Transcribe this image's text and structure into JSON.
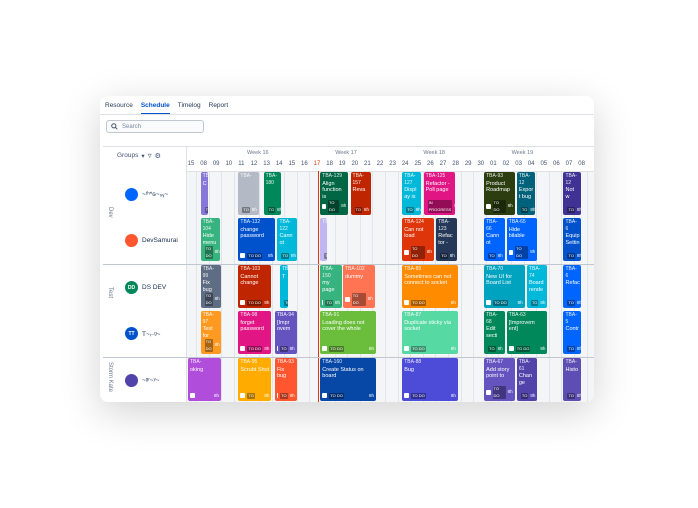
{
  "tabs": [
    "Resource",
    "Schedule",
    "Timelog",
    "Report"
  ],
  "active_tab": 1,
  "search": {
    "placeholder": "Search"
  },
  "groups_label": "Groups",
  "weeks": [
    {
      "label": "Week 16"
    },
    {
      "label": "Week 17"
    },
    {
      "label": "Week 18"
    },
    {
      "label": "Week 19"
    }
  ],
  "days": [
    "15",
    "08",
    "09",
    "10",
    "11",
    "12",
    "13",
    "14",
    "15",
    "16",
    "17",
    "18",
    "19",
    "20",
    "21",
    "22",
    "23",
    "24",
    "25",
    "26",
    "27",
    "28",
    "29",
    "30",
    "01",
    "02",
    "03",
    "04",
    "05",
    "06",
    "07",
    "08"
  ],
  "today_index": 10,
  "groups": [
    "Dev",
    "Test",
    "Storm Kate"
  ],
  "people": [
    {
      "name": "~ᵗʰ*ɢ~₉ᵧ~",
      "initials": "",
      "color": "#0065ff"
    },
    {
      "name": "DevSamurai",
      "initials": "",
      "color": "#ff5630"
    },
    {
      "name": "DS DEV",
      "initials": "DD",
      "color": "#00875a"
    },
    {
      "name": "T~ᵢ₋ᵍ~",
      "initials": "TT",
      "color": "#0052cc"
    },
    {
      "name": "~ᵍʳ~ʸ~",
      "initials": "",
      "color": "#5243aa"
    }
  ],
  "tasks": [
    {
      "id": "TBA-",
      "title": "C",
      "color": "#8777d9",
      "status": "TO",
      "hrs": "8h"
    },
    {
      "id": "TBA-",
      "title": "",
      "color": "#b3bac5",
      "status": "TO",
      "hrs": "8h"
    },
    {
      "id": "TBA-180",
      "title": "",
      "color": "#00875a",
      "status": "TO",
      "hrs": "8h"
    },
    {
      "id": "TBA-129",
      "title": "Align function is",
      "color": "#006644",
      "status": "TO DO",
      "hrs": "8h"
    },
    {
      "id": "TBA-157",
      "title": "Reva",
      "color": "#bf2600",
      "status": "TO",
      "hrs": "8h"
    },
    {
      "id": "TBA-127",
      "title": "Displ ay is",
      "color": "#00b8d9",
      "status": "TO",
      "hrs": "8h"
    },
    {
      "id": "TBA-125",
      "title": "Refactor - Poll page",
      "color": "#e11584",
      "status": "IN PROGRESS",
      "hrs": "8h"
    },
    {
      "id": "TBA-93",
      "title": "Product Roadmap",
      "color": "#2c3e10",
      "status": "TO DO",
      "hrs": "8h"
    },
    {
      "id": "TBA-12",
      "title": "Expor t bug",
      "color": "#00627a",
      "status": "TO",
      "hrs": "8h"
    },
    {
      "id": "TBA-12",
      "title": "Not w",
      "color": "#403294",
      "status": "TO",
      "hrs": "8h"
    },
    {
      "id": "TBA-104",
      "title": "Hide menu",
      "color": "#36b37e",
      "status": "TO DO",
      "hrs": "8h"
    },
    {
      "id": "TBA-132",
      "title": "change password",
      "color": "#0052cc",
      "status": "TO DO",
      "hrs": "8h"
    },
    {
      "id": "TBA-122",
      "title": "Cann ot",
      "color": "#00b8d9",
      "status": "TO",
      "hrs": "8h"
    },
    {
      "id": "TBA-",
      "title": "",
      "color": "#c0b6f2",
      "status": "TO",
      "hrs": "8h"
    },
    {
      "id": "TBA-124",
      "title": "Can not load",
      "color": "#de350b",
      "status": "TO DO",
      "hrs": "8h"
    },
    {
      "id": "TBA-123",
      "title": "Refac tor -",
      "color": "#253858",
      "status": "TO",
      "hrs": "8h"
    },
    {
      "id": "TBA-66",
      "title": "Cann ot",
      "color": "#0065ff",
      "status": "TO",
      "hrs": "8h"
    },
    {
      "id": "TBA-65",
      "title": "Hide bilable",
      "color": "#0065ff",
      "status": "TO DO",
      "hrs": "8h"
    },
    {
      "id": "TBA-6",
      "title": "Equip Settin",
      "color": "#0052cc",
      "status": "TO",
      "hrs": "8h"
    },
    {
      "id": "TBA-99",
      "title": "Fix bug",
      "color": "#5e6c84",
      "status": "TO DO",
      "hrs": "8h"
    },
    {
      "id": "TBA-103",
      "title": "Cannot change",
      "color": "#bf2600",
      "status": "TO DO",
      "hrs": "8h"
    },
    {
      "id": "TBA-",
      "title": "T",
      "color": "#00b8d9",
      "status": "TO",
      "hrs": "8h"
    },
    {
      "id": "TBA-150",
      "title": "my page",
      "color": "#36b37e",
      "status": "TO",
      "hrs": "8h"
    },
    {
      "id": "TBA-102",
      "title": "dummy",
      "color": "#ff7452",
      "status": "TO DO",
      "hrs": "8h"
    },
    {
      "id": "TBA-89",
      "title": "Sometimes can not connect to socket",
      "color": "#ff8b00",
      "status": "TO DO",
      "hrs": "8h"
    },
    {
      "id": "TBA-70",
      "title": "New UI for Board List",
      "color": "#00a3bf",
      "status": "TO DO",
      "hrs": "8h"
    },
    {
      "id": "TBA-74",
      "title": "Board rende",
      "color": "#00b8d9",
      "status": "TO",
      "hrs": "8h"
    },
    {
      "id": "TBA-6",
      "title": "Refac",
      "color": "#0065ff",
      "status": "TO",
      "hrs": "8h"
    },
    {
      "id": "TBA-97",
      "title": "Test for",
      "color": "#ff991f",
      "status": "TO DO",
      "hrs": "8h"
    },
    {
      "id": "TBA-98",
      "title": "forget password",
      "color": "#e11584",
      "status": "TO DO",
      "hrs": "8h"
    },
    {
      "id": "TBA-94",
      "title": "[Impr ovem",
      "color": "#6554c0",
      "status": "TO",
      "hrs": "8h"
    },
    {
      "id": "TBA-91",
      "title": "Loading does not cover the whole",
      "color": "#6abe3b",
      "status": "TO DO",
      "hrs": "8h"
    },
    {
      "id": "TBA-87",
      "title": "Duplicate sticky via socket",
      "color": "#57d9a3",
      "status": "TO DO",
      "hrs": "8h"
    },
    {
      "id": "TBA-68",
      "title": "Edit secti",
      "color": "#00875a",
      "status": "TO",
      "hrs": "8h"
    },
    {
      "id": "TBA-63",
      "title": "[Improvem ent]",
      "color": "#00875a",
      "status": "TO DO",
      "hrs": "8h"
    },
    {
      "id": "TBA-5",
      "title": "Contr",
      "color": "#0065ff",
      "status": "TO",
      "hrs": "8h"
    },
    {
      "id": "TBA-",
      "title": "oking",
      "color": "#b04ddb",
      "status": "",
      "hrs": "8h"
    },
    {
      "id": "TBA-95",
      "title": "Scrubt Shut",
      "color": "#ffab00",
      "status": "TO",
      "hrs": "8h"
    },
    {
      "id": "TBA-93",
      "title": "Fix bug",
      "color": "#ff5630",
      "status": "TO",
      "hrs": "8h"
    },
    {
      "id": "TBA-160",
      "title": "Create Status on board",
      "color": "#0747a6",
      "status": "TO DO",
      "hrs": "8h"
    },
    {
      "id": "TBA-88",
      "title": "Bug",
      "color": "#4c4cd9",
      "status": "TO DO",
      "hrs": "8h"
    },
    {
      "id": "TBA-67",
      "title": "Add story point to",
      "color": "#6554c0",
      "status": "TO DO",
      "hrs": "8h"
    },
    {
      "id": "TBA-61",
      "title": "Chan ge",
      "color": "#5243aa",
      "status": "TO",
      "hrs": "8h"
    },
    {
      "id": "TBA-",
      "title": "Histo",
      "color": "#5e4db2",
      "status": "TO",
      "hrs": "8h"
    }
  ]
}
